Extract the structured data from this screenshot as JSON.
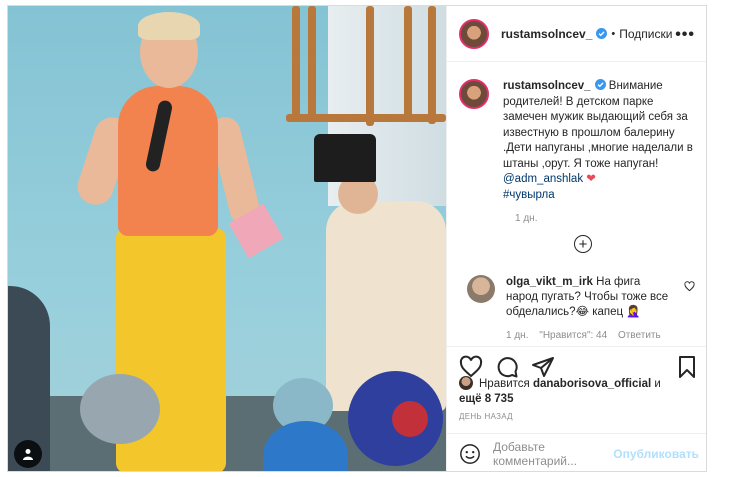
{
  "post": {
    "username": "rustamsolncev_",
    "follow_label": "Подписки",
    "follow_separator": "•",
    "more_label": "•••"
  },
  "caption": {
    "username": "rustamsolncev_",
    "text_before": " Внимание родителей! В детском парке замечен мужик выдающий себя за известную в прошлом балерину .Дети напуганы ,многие наделали в штаны ,орут. Я тоже напуган! ",
    "mention": "@adm_anshlak",
    "heart": "❤",
    "hashtag": "#чувырла",
    "time": "1 дн."
  },
  "comment": {
    "username": "olga_vikt_m_irk",
    "text": " На фига народ пугать? Чтобы тоже все обделались?😂 капец 🤦‍♀️",
    "time": "1 дн.",
    "likes": "\"Нравится\": 44",
    "reply_label": "Ответить"
  },
  "likes": {
    "prefix": "Нравится ",
    "liker": "danaborisova_official",
    "suffix": " и",
    "others": "ещё 8 735"
  },
  "posted_time": "ДЕНЬ НАЗАД",
  "add_comment": {
    "placeholder": "Добавьте комментарий...",
    "publish_label": "Опубликовать"
  },
  "icons": {
    "verified": "verified-badge-icon",
    "like": "heart-icon",
    "comment": "comment-icon",
    "share": "paper-plane-icon",
    "save": "bookmark-icon",
    "emoji": "smiley-icon",
    "profile": "person-icon"
  },
  "colors": {
    "link": "#00376b",
    "verified": "#3897f0",
    "muted": "#8e8e8e",
    "publish_disabled": "#b2dffc",
    "heart_red": "#ed4956"
  }
}
